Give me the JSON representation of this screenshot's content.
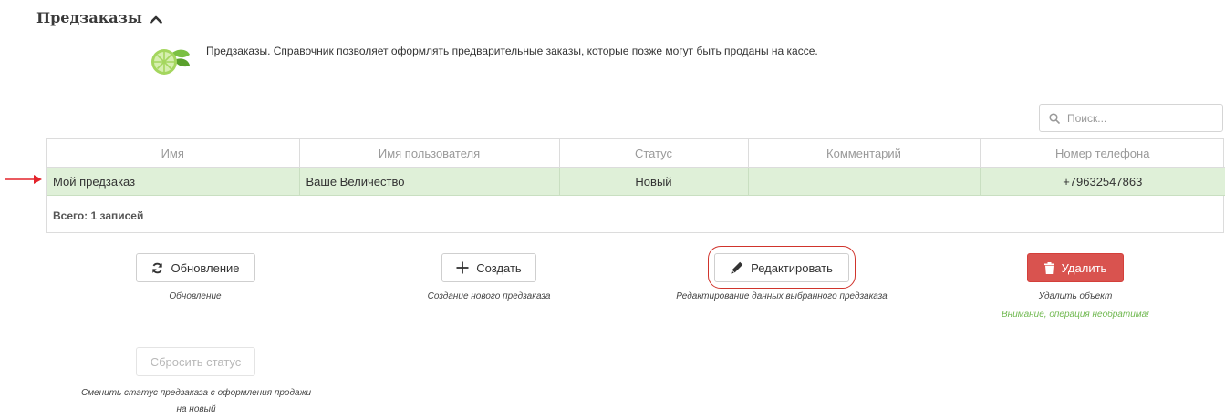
{
  "header": {
    "title": "Предзаказы",
    "description": "Предзаказы. Справочник позволяет оформлять предварительные заказы, которые позже могут быть проданы на кассе."
  },
  "search": {
    "placeholder": "Поиск..."
  },
  "table": {
    "columns": [
      "Имя",
      "Имя пользователя",
      "Статус",
      "Комментарий",
      "Номер телефона"
    ],
    "rows": [
      {
        "name": "Мой предзаказ",
        "user": "Ваше Величество",
        "status": "Новый",
        "comment": "",
        "phone": "+79632547863"
      }
    ],
    "total": "Всего: 1 записей"
  },
  "actions": {
    "refresh": {
      "label": "Обновление",
      "caption": "Обновление"
    },
    "create": {
      "label": "Создать",
      "caption": "Создание нового предзаказа"
    },
    "edit": {
      "label": "Редактировать",
      "caption": "Редактирование данных выбранного предзаказа"
    },
    "delete": {
      "label": "Удалить",
      "caption": "Удалить объект",
      "warning": "Внимание, операция необратима!"
    },
    "reset_status": {
      "label": "Сбросить статус",
      "caption_line1": "Сменить статус предзаказа с оформления продажи",
      "caption_line2": "на новый"
    }
  },
  "colors": {
    "selected_row": "#dff0d8",
    "danger": "#d9534f",
    "highlight_ring": "#d0342c",
    "warning_text": "#6fb84f"
  },
  "icons": {
    "section_toggle": "chevron-up-icon",
    "logo": "lime-icon",
    "search": "search-icon",
    "refresh": "refresh-icon",
    "create": "plus-icon",
    "edit": "pencil-icon",
    "delete": "trash-icon",
    "row_pointer": "arrow-right-icon"
  }
}
